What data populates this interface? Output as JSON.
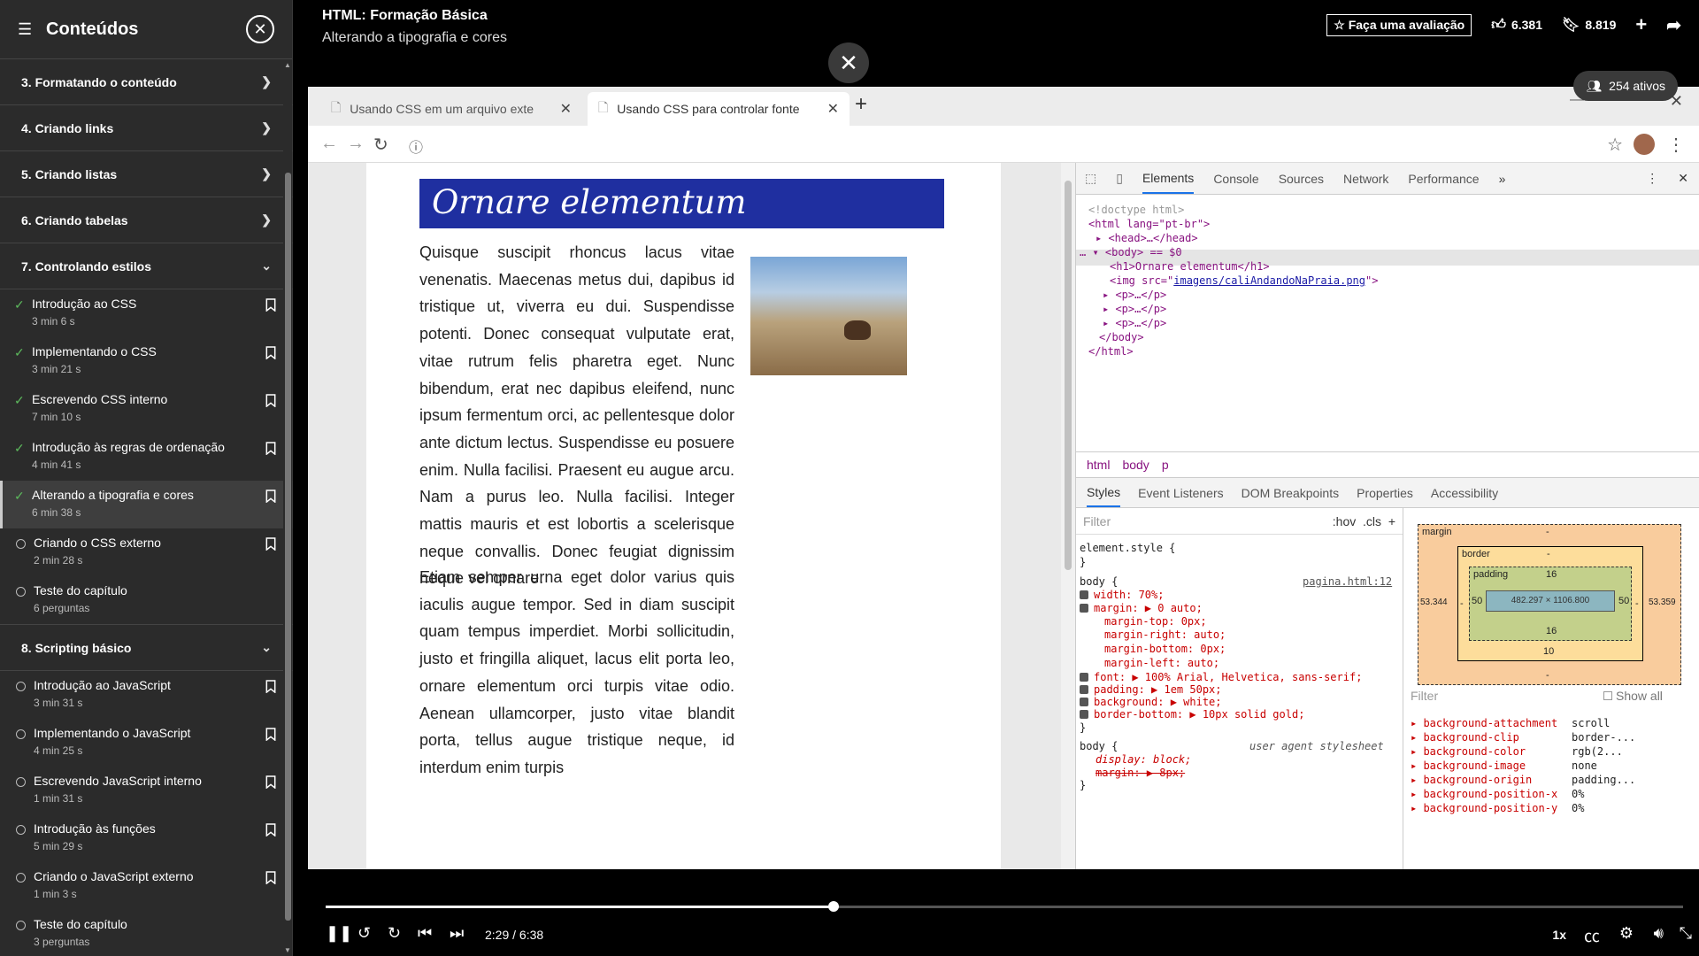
{
  "sidebar": {
    "title": "Conteúdos",
    "chapters_top": [
      {
        "label": "3. Formatando o conteúdo"
      },
      {
        "label": "4. Criando links"
      },
      {
        "label": "5. Criando listas"
      },
      {
        "label": "6. Criando tabelas"
      }
    ],
    "chapter7": {
      "label": "7. Controlando estilos",
      "lessons": [
        {
          "name": "Introdução ao CSS",
          "duration": "3 min 6 s",
          "done": true
        },
        {
          "name": "Implementando o CSS",
          "duration": "3 min 21 s",
          "done": true
        },
        {
          "name": "Escrevendo CSS interno",
          "duration": "7 min 10 s",
          "done": true
        },
        {
          "name": "Introdução às regras de ordenação",
          "duration": "4 min 41 s",
          "done": true
        },
        {
          "name": "Alterando a tipografia e cores",
          "duration": "6 min 38 s",
          "done": true
        },
        {
          "name": "Criando o CSS externo",
          "duration": "2 min 28 s",
          "done": false
        },
        {
          "name": "Teste do capítulo",
          "duration": "6 perguntas",
          "done": false
        }
      ]
    },
    "chapter8": {
      "label": "8. Scripting básico",
      "lessons": [
        {
          "name": "Introdução ao JavaScript",
          "duration": "3 min 31 s"
        },
        {
          "name": "Implementando o JavaScript",
          "duration": "4 min 25 s"
        },
        {
          "name": "Escrevendo JavaScript interno",
          "duration": "1 min 31 s"
        },
        {
          "name": "Introdução às funções",
          "duration": "5 min 29 s"
        },
        {
          "name": "Criando o JavaScript externo",
          "duration": "1 min 3 s"
        },
        {
          "name": "Teste do capítulo",
          "duration": "3 perguntas"
        }
      ]
    }
  },
  "header": {
    "course_title": "HTML: Formação Básica",
    "lesson_title": "Alterando a tipografia e cores",
    "rate_label": "Faça uma avaliação",
    "likes": "6.381",
    "saves": "8.819",
    "viewers": "254 ativos"
  },
  "browser": {
    "tab1": "Usando CSS em um arquivo exte",
    "tab2": "Usando CSS para controlar fonte"
  },
  "webpage": {
    "heading": "Ornare elementum",
    "para1": "Quisque suscipit rhoncus lacus vitae venenatis. Maecenas metus dui, dapibus id tristique ut, viverra eu dui. Suspendisse potenti. Donec consequat vulputate erat, vitae rutrum felis pharetra eget. Nunc bibendum, erat nec dapibus eleifend, nunc ipsum fermentum orci, ac pellentesque dolor ante dictum lectus. Suspendisse eu posuere enim. Nulla facilisi. Praesent eu augue arcu. Nam a purus leo. Nulla facilisi. Integer mattis mauris et est lobortis a scelerisque neque convallis. Donec feugiat dignissim neque vel ornare.",
    "para2": "Etiam semper urna eget dolor varius quis iaculis augue tempor. Sed in diam suscipit quam tempus imperdiet. Morbi sollicitudin, justo et fringilla aliquet, lacus elit porta leo, ornare elementum orci turpis vitae odio. Aenean ullamcorper, justo vitae blandit porta, tellus augue tristique neque, id interdum enim turpis"
  },
  "devtools": {
    "tabs": [
      "Elements",
      "Console",
      "Sources",
      "Network",
      "Performance"
    ],
    "dom": {
      "doctype": "<!doctype html>",
      "html_open": "<html lang=\"pt-br\">",
      "head": "<head>…</head>",
      "body_open": "<body> == $0",
      "h1": "<h1>Ornare elementum</h1>",
      "img_pre": "<img src=\"",
      "img_src": "imagens/caliAndandoNaPraia.png",
      "img_post": "\">",
      "p": "<p>…</p>",
      "body_close": "</body>",
      "html_close": "</html>"
    },
    "crumbs": [
      "html",
      "body",
      "p"
    ],
    "subtabs": [
      "Styles",
      "Event Listeners",
      "DOM Breakpoints",
      "Properties",
      "Accessibility"
    ],
    "filter_placeholder": "Filter",
    "hov": ":hov",
    "cls": ".cls",
    "styles": {
      "element_style": "element.style {",
      "close": "}",
      "body_sel": "body {",
      "source": "pagina.html:12",
      "width": "width: 70%;",
      "margin": "margin: ▶ 0 auto;",
      "margin_top": "margin-top: 0px;",
      "margin_right": "margin-right: auto;",
      "margin_bottom": "margin-bottom: 0px;",
      "margin_left": "margin-left: auto;",
      "font": "font: ▶ 100% Arial, Helvetica, sans-serif;",
      "padding": "padding: ▶ 1em 50px;",
      "background": "background: ▶ white;",
      "border_bottom": "border-bottom: ▶ 10px solid gold;",
      "ua_sel": "body {",
      "ua_source": "user agent stylesheet",
      "ua_display": "display: block;",
      "ua_margin": "margin: ▶ 8px;"
    },
    "boxmodel": {
      "margin_label": "margin",
      "border_label": "border",
      "padding_label": "padding",
      "content": "482.297 × 1106.800",
      "margin_top": "-",
      "margin_bottom": "-",
      "margin_left": "53.344",
      "margin_right": "53.359",
      "border_top": "-",
      "border_bottom": "10",
      "padding_top": "16",
      "padding_bottom": "16",
      "padding_left": "50",
      "padding_right": "50",
      "border_left": "-",
      "border_right": "-"
    },
    "computed_filter": "Filter",
    "show_all": "Show all",
    "computed": [
      {
        "prop": "background-attachment",
        "val": "scroll"
      },
      {
        "prop": "background-clip",
        "val": "border-..."
      },
      {
        "prop": "background-color",
        "val": "rgb(2..."
      },
      {
        "prop": "background-image",
        "val": "none"
      },
      {
        "prop": "background-origin",
        "val": "padding..."
      },
      {
        "prop": "background-position-x",
        "val": "0%"
      },
      {
        "prop": "background-position-y",
        "val": "0%"
      }
    ]
  },
  "player": {
    "time": "2:29 / 6:38",
    "progress_fraction": 0.374,
    "speed": "1x"
  }
}
